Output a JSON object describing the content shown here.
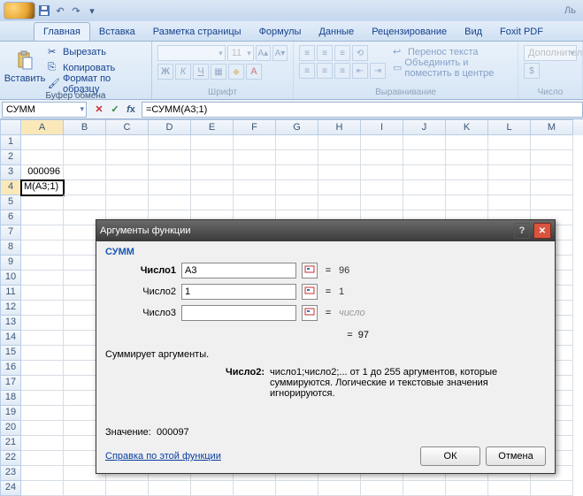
{
  "qat": {
    "title_suffix": "Ль"
  },
  "tabs": {
    "home": "Главная",
    "insert": "Вставка",
    "layout": "Разметка страницы",
    "formulas": "Формулы",
    "data": "Данные",
    "review": "Рецензирование",
    "view": "Вид",
    "foxit": "Foxit PDF"
  },
  "ribbon": {
    "paste": "Вставить",
    "cut": "Вырезать",
    "copy": "Копировать",
    "format_painter": "Формат по образцу",
    "clipboard_grp": "Буфер обмена",
    "font_name": "",
    "font_size": "11",
    "font_grp": "Шрифт",
    "wrap": "Перенос текста",
    "merge": "Объединить и поместить в центре",
    "align_grp": "Выравнивание",
    "extra": "Дополнительны",
    "number_grp": "Число"
  },
  "formula_bar": {
    "name": "СУММ",
    "formula": "=СУММ(A3;1)"
  },
  "sheet": {
    "cols": [
      "A",
      "B",
      "C",
      "D",
      "E",
      "F",
      "G",
      "H",
      "I",
      "J",
      "K",
      "L",
      "M"
    ],
    "rows": [
      "1",
      "2",
      "3",
      "4",
      "5",
      "6",
      "7",
      "8",
      "9",
      "10",
      "11",
      "12",
      "13",
      "14",
      "15",
      "16",
      "17",
      "18",
      "19",
      "20",
      "21",
      "22",
      "23",
      "24"
    ],
    "a3": "000096",
    "a4": "М(А3;1)"
  },
  "dialog": {
    "title": "Аргументы функции",
    "fn": "СУММ",
    "arg1_label": "Число1",
    "arg1_value": "A3",
    "arg1_result": "96",
    "arg2_label": "Число2",
    "arg2_value": "1",
    "arg2_result": "1",
    "arg3_label": "Число3",
    "arg3_value": "",
    "arg3_ph": "число",
    "eq": "=",
    "result": "97",
    "desc": "Суммирует аргументы.",
    "argdesc_label": "Число2:",
    "argdesc": "число1;число2;... от 1 до 255 аргументов, которые суммируются. Логические и текстовые значения игнорируются.",
    "value_label": "Значение:",
    "value": "000097",
    "help": "Справка по этой функции",
    "ok": "ОК",
    "cancel": "Отмена"
  }
}
